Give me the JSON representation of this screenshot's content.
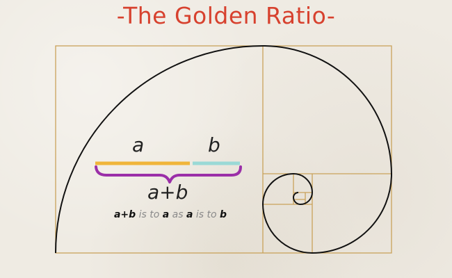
{
  "title": "-The Golden Ratio-",
  "labels": {
    "a": "a",
    "b": "b",
    "sum": "a+b"
  },
  "caption": {
    "t1": "a+b",
    "t2": " is to ",
    "t3": "a",
    "t4": " as ",
    "t5": "a",
    "t6": " is to ",
    "t7": "b"
  },
  "colors": {
    "title": "#d7412e",
    "segment_a": "#f0b53a",
    "segment_b": "#9ad9d6",
    "brace": "#9b2fa8",
    "grid_lines": "#c9a25a",
    "spiral": "#111111"
  }
}
